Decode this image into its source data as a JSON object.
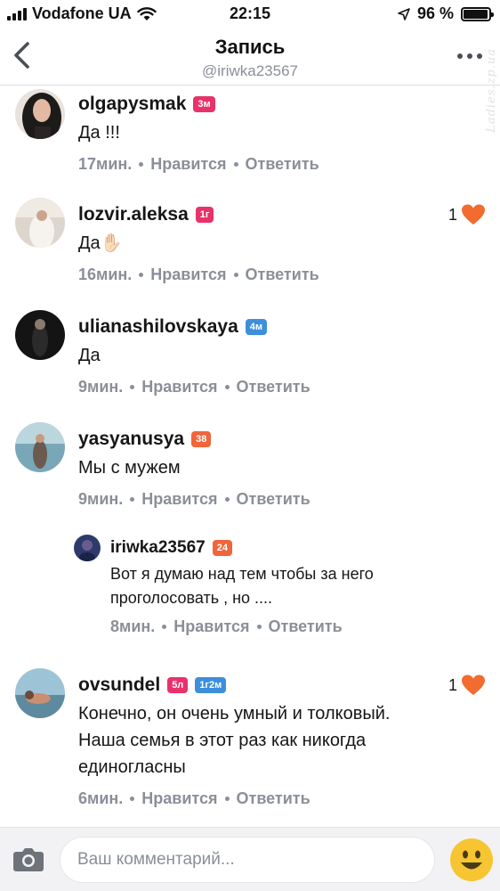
{
  "status": {
    "carrier": "Vodafone UA",
    "time": "22:15",
    "battery": "96 %",
    "battery_level": 0.96
  },
  "nav": {
    "title": "Запись",
    "subtitle": "@iriwka23567",
    "watermark": "Ladies.zp.ua"
  },
  "comments": [
    {
      "username": "olgapysmak",
      "badges": [
        "3м"
      ],
      "text": "Да !!!",
      "time": "17мин.",
      "like_label": "Нравится",
      "reply_label": "Ответить",
      "likes": ""
    },
    {
      "username": "lozvir.aleksa",
      "badges": [
        "1г"
      ],
      "text": "Да✋🏻",
      "time": "16мин.",
      "like_label": "Нравится",
      "reply_label": "Ответить",
      "likes": "1"
    },
    {
      "username": "ulianashilovskaya",
      "badges": [
        "4м"
      ],
      "text": "Да",
      "time": "9мин.",
      "like_label": "Нравится",
      "reply_label": "Ответить",
      "likes": ""
    },
    {
      "username": "yasyanusya",
      "badges": [
        "38"
      ],
      "text": "Мы с мужем",
      "time": "9мин.",
      "like_label": "Нравится",
      "reply_label": "Ответить",
      "likes": ""
    },
    {
      "username": "iriwka23567",
      "badges": [
        "24"
      ],
      "text_line1": "Вот я думаю над тем чтобы за него",
      "text_line2": "проголосовать , но ....",
      "time": "8мин.",
      "like_label": "Нравится",
      "reply_label": "Ответить",
      "likes": ""
    },
    {
      "username": "ovsundel",
      "badges": [
        "5л",
        "1г2м"
      ],
      "text_line1": "Конечно, он очень умный и толковый.",
      "text_line2": "Наша семья в этот раз как никогда",
      "text_line3": "единогласны",
      "time": "6мин.",
      "like_label": "Нравится",
      "reply_label": "Ответить",
      "likes": "1"
    }
  ],
  "input": {
    "placeholder": "Ваш комментарий..."
  },
  "colors": {
    "badge_red": "#e8326b",
    "badge_blue": "#3d8fdc",
    "badge_orange": "#f0653a",
    "heart": "#f26b2f",
    "meta_gray": "#8a8f98"
  }
}
